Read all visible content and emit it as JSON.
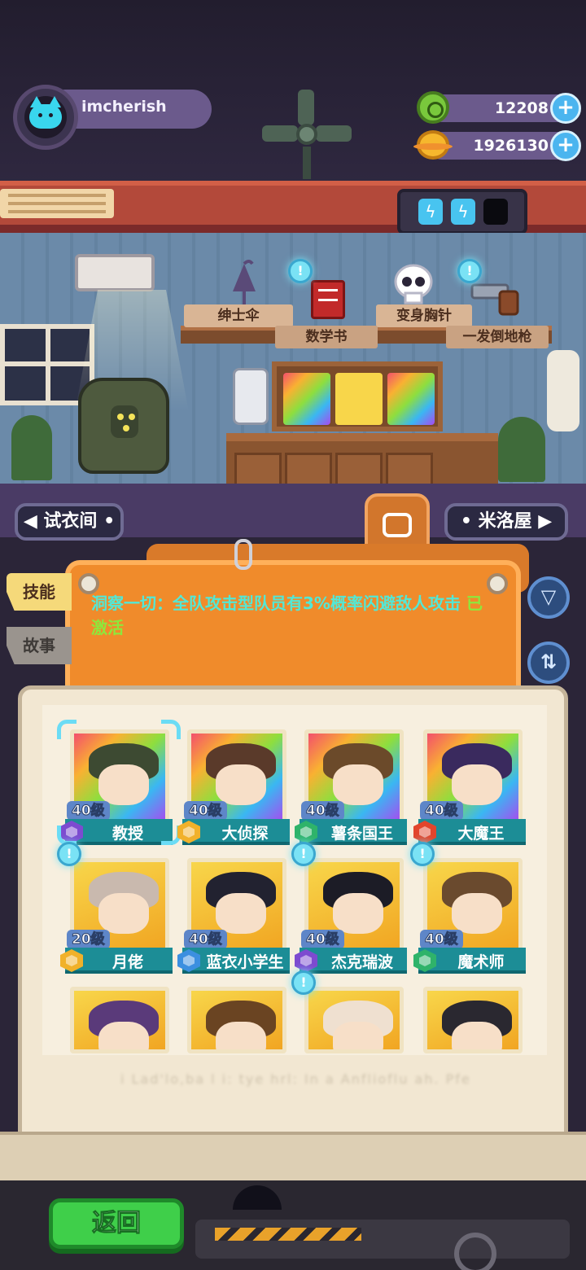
{
  "player": {
    "name": "imcherish"
  },
  "currencies": [
    {
      "icon": "green-gem-coin-icon",
      "value": "12208",
      "plus": "+"
    },
    {
      "icon": "gold-planet-coin-icon",
      "value": "1926130",
      "plus": "+"
    }
  ],
  "energy": {
    "icon": "battery-icon",
    "full": 2,
    "empty": 1
  },
  "room": {
    "items": [
      {
        "label": "绅士伞",
        "icon": "umbrella-icon"
      },
      {
        "label": "数学书",
        "icon": "math-book-icon"
      },
      {
        "label": "变身胸针",
        "icon": "skull-brooch-icon"
      },
      {
        "label": "一发倒地枪",
        "icon": "revolver-icon"
      }
    ],
    "left_button": "试衣间",
    "right_button": "米洛屋",
    "nav_left_icon": "triangle-left-icon",
    "nav_right_icon": "triangle-right-icon"
  },
  "tabs": [
    {
      "label": "技能",
      "active": true
    },
    {
      "label": "故事",
      "active": false
    }
  ],
  "skill": {
    "text": "洞察一切：全队攻击型队员有3%概率闪避敌人攻击",
    "status": "已激活"
  },
  "side_buttons": [
    {
      "icon": "filter-icon",
      "glyph": "▽"
    },
    {
      "icon": "sort-icon",
      "glyph": "⇅"
    }
  ],
  "characters": [
    {
      "name": "教授",
      "level": "40级",
      "bg": "rainbow",
      "gem": "#7d4bd0",
      "selected": true,
      "alert": false
    },
    {
      "name": "大侦探",
      "level": "40级",
      "bg": "rainbow",
      "gem": "#f1b12a",
      "selected": false,
      "alert": false
    },
    {
      "name": "薯条国王",
      "level": "40级",
      "bg": "rainbow",
      "gem": "#2fb36a",
      "selected": false,
      "alert": false
    },
    {
      "name": "大魔王",
      "level": "40级",
      "bg": "rainbow",
      "gem": "#e2452c",
      "selected": false,
      "alert": false
    },
    {
      "name": "月佬",
      "level": "20级",
      "bg": "gold",
      "gem": "#f1b12a",
      "selected": false,
      "alert": true
    },
    {
      "name": "蓝衣小学生",
      "level": "40级",
      "bg": "gold",
      "gem": "#3c8fe0",
      "selected": false,
      "alert": false
    },
    {
      "name": "杰克瑞波",
      "level": "40级",
      "bg": "gold",
      "gem": "#7d4bd0",
      "selected": false,
      "alert": true
    },
    {
      "name": "魔术师",
      "level": "40级",
      "bg": "gold",
      "gem": "#2fb36a",
      "selected": false,
      "alert": true
    },
    {
      "name": "",
      "level": "",
      "bg": "gold",
      "gem": "",
      "selected": false,
      "alert": false
    },
    {
      "name": "",
      "level": "",
      "bg": "gold",
      "gem": "",
      "selected": false,
      "alert": false
    },
    {
      "name": "",
      "level": "",
      "bg": "gold",
      "gem": "",
      "selected": false,
      "alert": true
    },
    {
      "name": "",
      "level": "",
      "bg": "gold",
      "gem": "",
      "selected": false,
      "alert": false
    }
  ],
  "footer_text": "i Lad'lo,ba l i: tye    hrl: In a Anflioflu ah. Pfe",
  "back_button": "返回"
}
